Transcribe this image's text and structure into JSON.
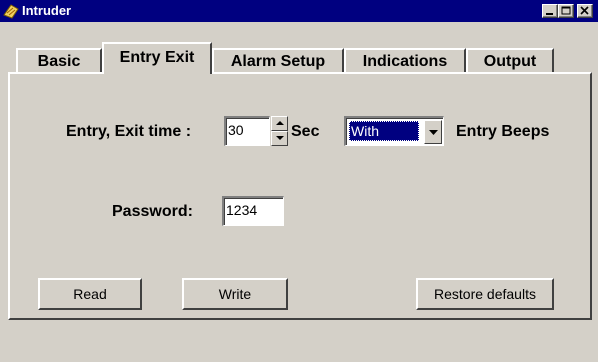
{
  "window": {
    "title": "Intruder",
    "icon": "intruder-app-icon",
    "controls": [
      "minimize-icon",
      "maximize-icon",
      "close-icon"
    ]
  },
  "tabs": [
    {
      "label": "Basic",
      "active": false
    },
    {
      "label": "Entry Exit",
      "active": true
    },
    {
      "label": "Alarm Setup",
      "active": false
    },
    {
      "label": "Indications",
      "active": false
    },
    {
      "label": "Output",
      "active": false
    }
  ],
  "entry_exit": {
    "time_label": "Entry, Exit time :",
    "time_value": "30",
    "time_unit": "Sec",
    "beeps_selected": "With",
    "beeps_label": "Entry Beeps",
    "password_label": "Password:",
    "password_value": "1234"
  },
  "buttons": {
    "read": "Read",
    "write": "Write",
    "restore": "Restore defaults"
  },
  "colors": {
    "titlebar": "#000080",
    "face": "#d4d0c8",
    "selection": "#000080"
  }
}
